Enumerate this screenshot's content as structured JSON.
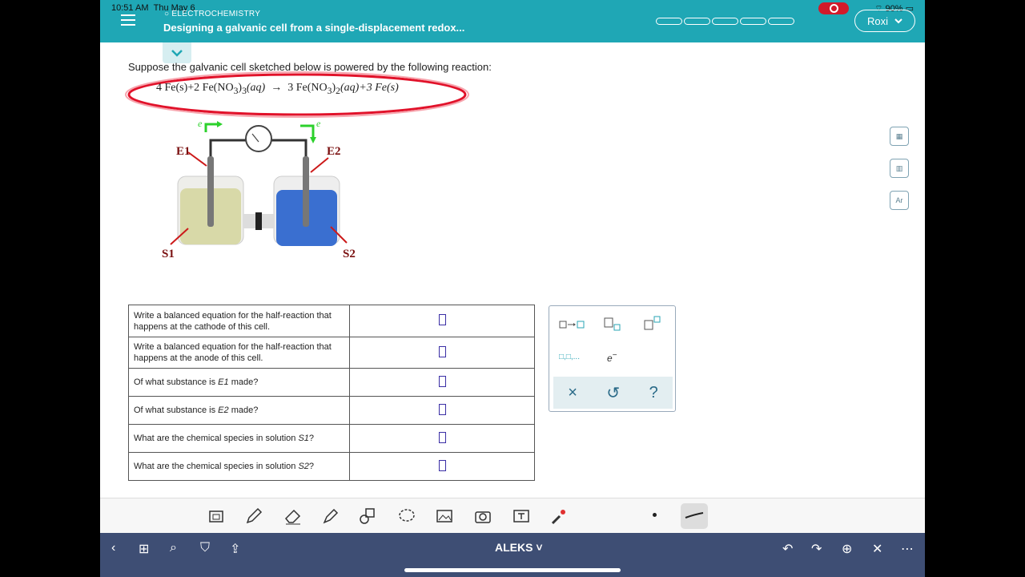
{
  "status_bar": {
    "time": "10:51 AM",
    "date": "Thu May 6",
    "battery": "90%"
  },
  "header": {
    "topic": "ELECTROCHEMISTRY",
    "title": "Designing a galvanic cell from a single-displacement redox...",
    "user": "Roxi"
  },
  "question": {
    "prompt": "Suppose the galvanic cell sketched below is powered by the following reaction:",
    "eq_left": "4 Fe(s)+2 Fe(NO",
    "eq_sub1": "3",
    "eq_sub2": "3",
    "eq_phase1": "(aq)",
    "eq_arrow": "→",
    "eq_right": "3 Fe(NO",
    "eq_sub3": "3",
    "eq_sub4": "2",
    "eq_phase2": "(aq)+3 Fe(s)"
  },
  "diagram": {
    "e1": "E1",
    "e2": "E2",
    "s1": "S1",
    "s2": "S2",
    "electron": "e",
    "colors": {
      "left_solution": "#d8d9a8",
      "right_solution": "#3a6fd0",
      "arrow": "#cc1a1a",
      "electron_arrow": "#2cd12c"
    }
  },
  "table": {
    "rows": [
      {
        "q": "Write a balanced equation for the half-reaction that happens at the cathode of this cell."
      },
      {
        "q": "Write a balanced equation for the half-reaction that happens at the anode of this cell."
      },
      {
        "q1": "Of what substance is ",
        "var": "E1",
        "q2": " made?"
      },
      {
        "q1": "Of what substance is ",
        "var": "E2",
        "q2": " made?"
      },
      {
        "q1": "What are the chemical species in solution ",
        "var": "S1",
        "q2": "?"
      },
      {
        "q1": "What are the chemical species in solution ",
        "var": "S2",
        "q2": "?"
      }
    ]
  },
  "palette": {
    "electron": "e",
    "times": "×",
    "undo": "↺",
    "help": "?",
    "list": "□,□,..."
  },
  "bottom": {
    "app_name": "ALEKS"
  },
  "colors": {
    "header": "#1fa7b5",
    "bottom_bar": "#3e4e74",
    "record": "#d21a2a"
  }
}
